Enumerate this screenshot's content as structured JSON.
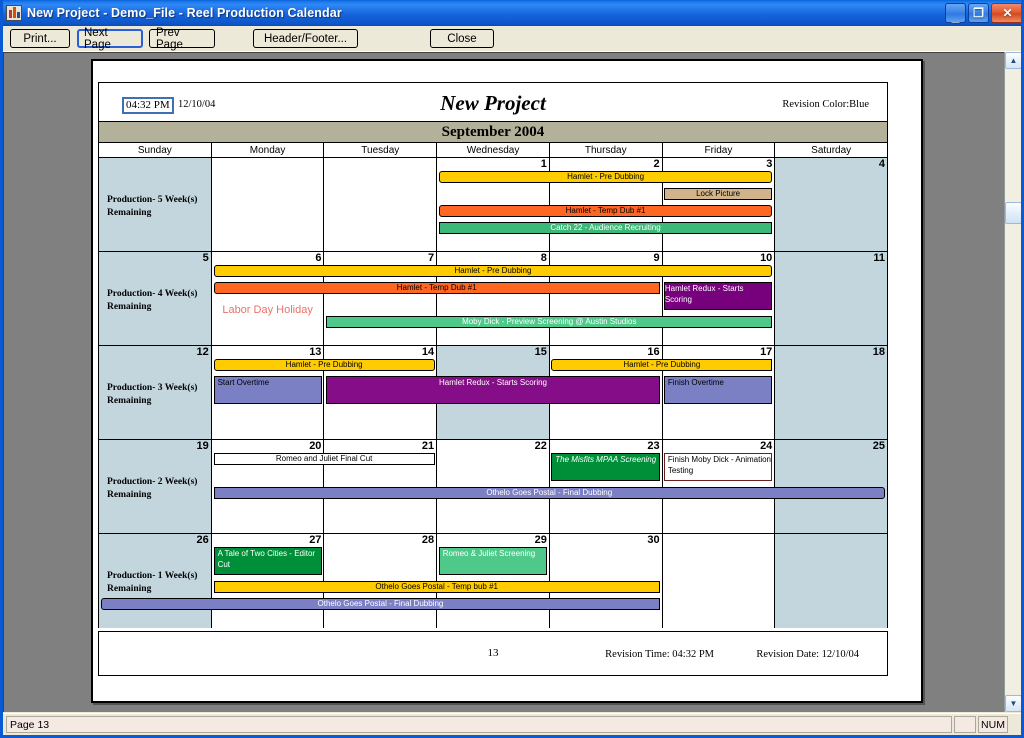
{
  "window": {
    "title": "New Project - Demo_File - Reel Production Calendar",
    "icon": "app-icon",
    "minimize": "_",
    "maximize": "❐",
    "close": "✕"
  },
  "toolbar": {
    "print_label": "Print...",
    "next_page_label": "Next Page",
    "prev_page_label": "Prev Page",
    "header_footer_label": "Header/Footer...",
    "close_label": "Close"
  },
  "report": {
    "time": "04:32 PM",
    "date": "12/10/04",
    "title": "New Project",
    "revision_color": "Revision Color:Blue",
    "month": "September 2004",
    "page_number": "13",
    "revision_time": "Revision Time: 04:32 PM",
    "revision_date": "Revision Date: 12/10/04"
  },
  "calendar": {
    "day_names": [
      "Sunday",
      "Monday",
      "Tuesday",
      "Wednesday",
      "Thursday",
      "Friday",
      "Saturday"
    ],
    "weeks": [
      {
        "production_label": "Production- 5 Week(s) Remaining",
        "days": [
          {
            "num": "",
            "shaded": true
          },
          {
            "num": "",
            "shaded": false
          },
          {
            "num": "",
            "shaded": false
          },
          {
            "num": "1",
            "shaded": false
          },
          {
            "num": "2",
            "shaded": false
          },
          {
            "num": "3",
            "shaded": false
          },
          {
            "num": "4",
            "shaded": true
          }
        ],
        "holiday": "",
        "events": [
          {
            "label": "Hamlet - Pre Dubbing",
            "start": 3,
            "end": 5,
            "row": 0,
            "fill": "#FFCC00",
            "text": "#000000",
            "align": "center",
            "arrow_left": true,
            "arrow_right": true
          },
          {
            "label": "Lock Picture",
            "start": 5,
            "end": 5,
            "row": 1,
            "fill": "#D2B48C",
            "text": "#000000",
            "align": "center",
            "arrow_left": false,
            "arrow_right": false
          },
          {
            "label": "Hamlet - Temp Dub #1",
            "start": 3,
            "end": 5,
            "row": 2,
            "fill": "#FF6622",
            "text": "#000000",
            "align": "center",
            "arrow_left": true,
            "arrow_right": true
          },
          {
            "label": "Catch 22 - Audience Recruiting",
            "start": 3,
            "end": 5,
            "row": 3,
            "fill": "#3CB878",
            "text": "#FFFFFF",
            "align": "center",
            "arrow_left": false,
            "arrow_right": false
          }
        ]
      },
      {
        "production_label": "Production- 4 Week(s) Remaining",
        "days": [
          {
            "num": "5",
            "shaded": true
          },
          {
            "num": "6",
            "shaded": false
          },
          {
            "num": "7",
            "shaded": false
          },
          {
            "num": "8",
            "shaded": false
          },
          {
            "num": "9",
            "shaded": false
          },
          {
            "num": "10",
            "shaded": false
          },
          {
            "num": "11",
            "shaded": true
          }
        ],
        "holiday": "Labor Day Holiday",
        "events": [
          {
            "label": "Hamlet - Pre Dubbing",
            "start": 1,
            "end": 5,
            "row": 0,
            "fill": "#FFCC00",
            "text": "#000000",
            "align": "center",
            "arrow_left": true,
            "arrow_right": true
          },
          {
            "label": "Hamlet - Temp Dub #1",
            "start": 1,
            "end": 4,
            "row": 1,
            "fill": "#FF6622",
            "text": "#000000",
            "align": "center",
            "arrow_left": true,
            "arrow_right": false
          },
          {
            "label": "Hamlet Redux - Starts Scoring",
            "start": 5,
            "end": 5,
            "row": 1,
            "fill": "#77007C",
            "text": "#FFFFFF",
            "align": "center",
            "arrow_left": false,
            "arrow_right": false,
            "tall": true
          },
          {
            "label": "Moby Dick - Preview Screening @ Austin Studios",
            "start": 2,
            "end": 5,
            "row": 3,
            "fill": "#4FC98A",
            "text": "#FFFFFF",
            "align": "center",
            "arrow_left": false,
            "arrow_right": false
          }
        ]
      },
      {
        "production_label": "Production- 3 Week(s) Remaining",
        "days": [
          {
            "num": "12",
            "shaded": true
          },
          {
            "num": "13",
            "shaded": false
          },
          {
            "num": "14",
            "shaded": false
          },
          {
            "num": "15",
            "shaded": true
          },
          {
            "num": "16",
            "shaded": false
          },
          {
            "num": "17",
            "shaded": false
          },
          {
            "num": "18",
            "shaded": true
          }
        ],
        "holiday": "",
        "events": [
          {
            "label": "Hamlet - Pre Dubbing",
            "start": 1,
            "end": 2,
            "row": 0,
            "fill": "#FFCC00",
            "text": "#000000",
            "align": "center",
            "arrow_left": true,
            "arrow_right": true
          },
          {
            "label": "Hamlet - Pre Dubbing",
            "start": 4,
            "end": 5,
            "row": 0,
            "fill": "#FFCC00",
            "text": "#000000",
            "align": "center",
            "arrow_left": true,
            "arrow_right": false
          },
          {
            "label": "Start Overtime",
            "start": 1,
            "end": 1,
            "row": 1,
            "fill": "#7B7FC4",
            "text": "#000000",
            "align": "left",
            "arrow_left": false,
            "arrow_right": false,
            "tall": true
          },
          {
            "label": "Hamlet Redux - Starts Scoring",
            "start": 2,
            "end": 4,
            "row": 1,
            "fill": "#850D87",
            "text": "#FFFFFF",
            "align": "center",
            "arrow_left": false,
            "arrow_right": false,
            "tall": true
          },
          {
            "label": "Finish Overtime",
            "start": 5,
            "end": 5,
            "row": 1,
            "fill": "#7B7FC4",
            "text": "#000000",
            "align": "left",
            "arrow_left": false,
            "arrow_right": false,
            "tall": true
          }
        ]
      },
      {
        "production_label": "Production- 2 Week(s) Remaining",
        "days": [
          {
            "num": "19",
            "shaded": true
          },
          {
            "num": "20",
            "shaded": false
          },
          {
            "num": "21",
            "shaded": false
          },
          {
            "num": "22",
            "shaded": false
          },
          {
            "num": "23",
            "shaded": false
          },
          {
            "num": "24",
            "shaded": false
          },
          {
            "num": "25",
            "shaded": true
          }
        ],
        "holiday": "",
        "events": [
          {
            "label": "Romeo and Juliet Final Cut",
            "start": 1,
            "end": 2,
            "row": 0,
            "fill": "#FFFFFF",
            "text": "#000000",
            "align": "center",
            "arrow_left": false,
            "arrow_right": false
          },
          {
            "label": "The Misfits MPAA Screening",
            "start": 4,
            "end": 4,
            "row": 0,
            "fill": "#008F39",
            "text": "#FFFFFF",
            "align": "left",
            "arrow_left": false,
            "arrow_right": false,
            "tall": true,
            "italic": true
          },
          {
            "label": "Finish Moby Dick - Animation Testing",
            "start": 5,
            "end": 5,
            "row": 0,
            "fill": "#FFFFFF",
            "text": "#000000",
            "align": "left",
            "arrow_left": false,
            "arrow_right": false,
            "tall": true,
            "border": "#6B1E1E"
          },
          {
            "label": "Othelo Goes Postal - Final Dubbing",
            "start": 1,
            "end": 6,
            "row": 2,
            "fill": "#7B7FC4",
            "text": "#FFFFFF",
            "align": "center",
            "arrow_left": false,
            "arrow_right": true
          }
        ]
      },
      {
        "production_label": "Production- 1 Week(s) Remaining",
        "days": [
          {
            "num": "26",
            "shaded": true
          },
          {
            "num": "27",
            "shaded": false
          },
          {
            "num": "28",
            "shaded": false
          },
          {
            "num": "29",
            "shaded": false
          },
          {
            "num": "30",
            "shaded": false
          },
          {
            "num": "",
            "shaded": false
          },
          {
            "num": "",
            "shaded": true
          }
        ],
        "holiday": "",
        "events": [
          {
            "label": "A Tale of Two Cities - Editor Cut",
            "start": 1,
            "end": 1,
            "row": 0,
            "fill": "#008F39",
            "text": "#FFFFFF",
            "align": "left",
            "arrow_left": false,
            "arrow_right": false,
            "tall": true
          },
          {
            "label": "Romeo & Juliet Screening",
            "start": 3,
            "end": 3,
            "row": 0,
            "fill": "#4FC98A",
            "text": "#FFFFFF",
            "align": "left",
            "arrow_left": false,
            "arrow_right": false,
            "tall": true
          },
          {
            "label": "Othelo Goes Postal - Temp bub #1",
            "start": 1,
            "end": 4,
            "row": 2,
            "fill": "#FFCC00",
            "text": "#000000",
            "align": "center",
            "arrow_left": false,
            "arrow_right": false
          },
          {
            "label": "Othelo Goes Postal - Final Dubbing",
            "start": 0,
            "end": 4,
            "row": 3,
            "fill": "#7B7FC4",
            "text": "#FFFFFF",
            "align": "center",
            "arrow_left": true,
            "arrow_right": false
          }
        ]
      }
    ]
  },
  "scrollbar": {
    "up_arrow": "▲",
    "down_arrow": "▼"
  },
  "statusbar": {
    "message": "Page 13",
    "blank": "",
    "num_indicator": "NUM"
  }
}
